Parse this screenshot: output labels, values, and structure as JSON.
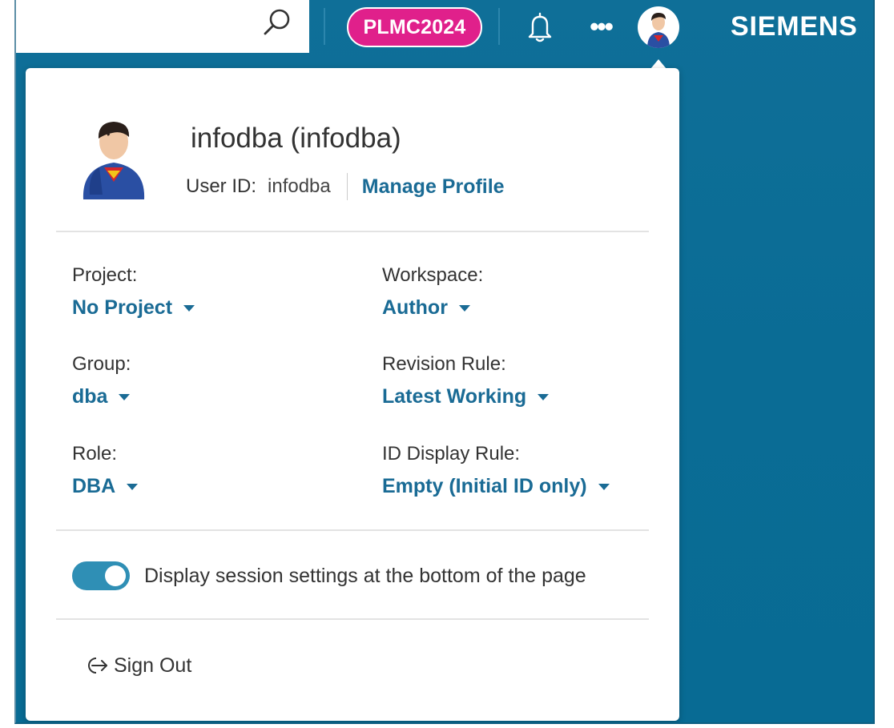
{
  "header": {
    "project_badge": "PLMC2024",
    "more_label": "•••",
    "brand": "SIEMENS",
    "icons": {
      "search": "search-icon",
      "notifications": "bell-icon",
      "more": "more-icon",
      "avatar": "avatar"
    }
  },
  "profile": {
    "display_name": "infodba (infodba)",
    "user_id_label": "User ID:",
    "user_id_value": "infodba",
    "manage_link": "Manage Profile"
  },
  "session": {
    "project": {
      "label": "Project:",
      "value": "No Project"
    },
    "workspace": {
      "label": "Workspace:",
      "value": "Author"
    },
    "group": {
      "label": "Group:",
      "value": "dba"
    },
    "revision_rule": {
      "label": "Revision Rule:",
      "value": "Latest Working"
    },
    "role": {
      "label": "Role:",
      "value": "DBA"
    },
    "id_display_rule": {
      "label": "ID Display Rule:",
      "value": "Empty (Initial ID only)"
    }
  },
  "display_settings": {
    "label": "Display session settings at the bottom of the page",
    "enabled": true
  },
  "sign_out": {
    "label": "Sign Out",
    "icon": "sign-out-icon"
  },
  "colors": {
    "header_bg": "#0a6c95",
    "accent_link": "#1a6b95",
    "badge": "#e0208b",
    "toggle_on": "#2f8fb5"
  }
}
